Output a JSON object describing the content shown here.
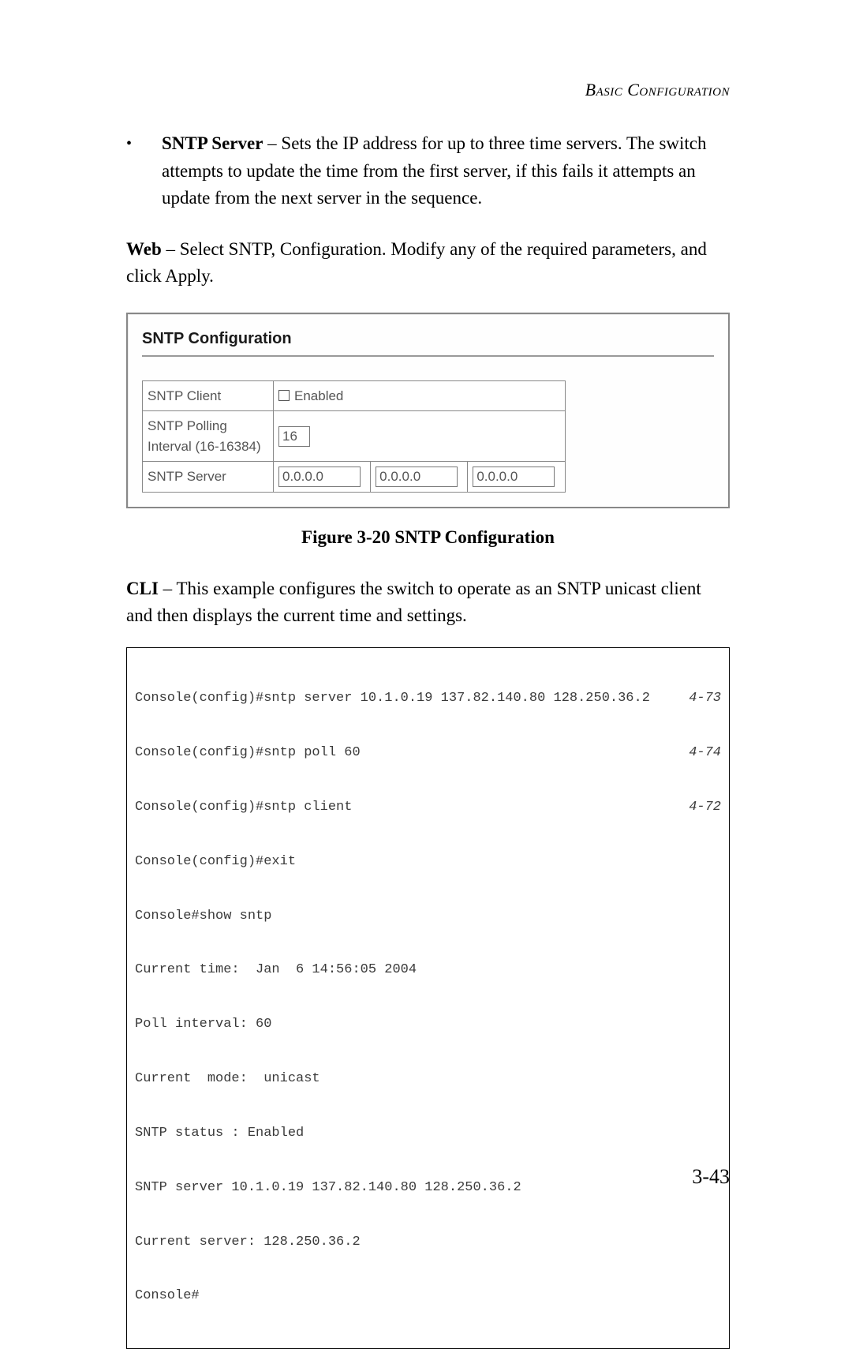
{
  "header": {
    "section_label": "Basic Configuration"
  },
  "bullet": {
    "term": "SNTP Server",
    "text": " – Sets the IP address for up to three time servers. The switch attempts to update the time from the first server, if this fails it attempts an update from the next server in the sequence."
  },
  "web_para": {
    "lead": "Web",
    "text": " – Select SNTP, Configuration. Modify any of the required parameters, and click Apply."
  },
  "screenshot": {
    "title": "SNTP Configuration",
    "rows": {
      "client_label": "SNTP Client",
      "client_checkbox": "Enabled",
      "polling_label": "SNTP Polling Interval (16-16384)",
      "polling_value": "16",
      "server_label": "SNTP Server",
      "server_values": [
        "0.0.0.0",
        "0.0.0.0",
        "0.0.0.0"
      ]
    }
  },
  "figure_caption": "Figure 3-20  SNTP Configuration",
  "cli_para": {
    "lead": "CLI",
    "text": " – This example configures the switch to operate as an SNTP unicast client and then displays the current time and settings."
  },
  "cli_lines": [
    {
      "cmd": "Console(config)#sntp server 10.1.0.19 137.82.140.80 128.250.36.2",
      "ref": "4-73"
    },
    {
      "cmd": "Console(config)#sntp poll 60",
      "ref": "4-74"
    },
    {
      "cmd": "Console(config)#sntp client",
      "ref": "4-72"
    },
    {
      "cmd": "Console(config)#exit",
      "ref": ""
    },
    {
      "cmd": "Console#show sntp",
      "ref": ""
    },
    {
      "cmd": "Current time:  Jan  6 14:56:05 2004",
      "ref": ""
    },
    {
      "cmd": "Poll interval: 60",
      "ref": ""
    },
    {
      "cmd": "Current  mode:  unicast",
      "ref": ""
    },
    {
      "cmd": "SNTP status : Enabled",
      "ref": ""
    },
    {
      "cmd": "SNTP server 10.1.0.19 137.82.140.80 128.250.36.2",
      "ref": ""
    },
    {
      "cmd": "Current server: 128.250.36.2",
      "ref": ""
    },
    {
      "cmd": "Console#",
      "ref": ""
    }
  ],
  "page_number": "3-43"
}
